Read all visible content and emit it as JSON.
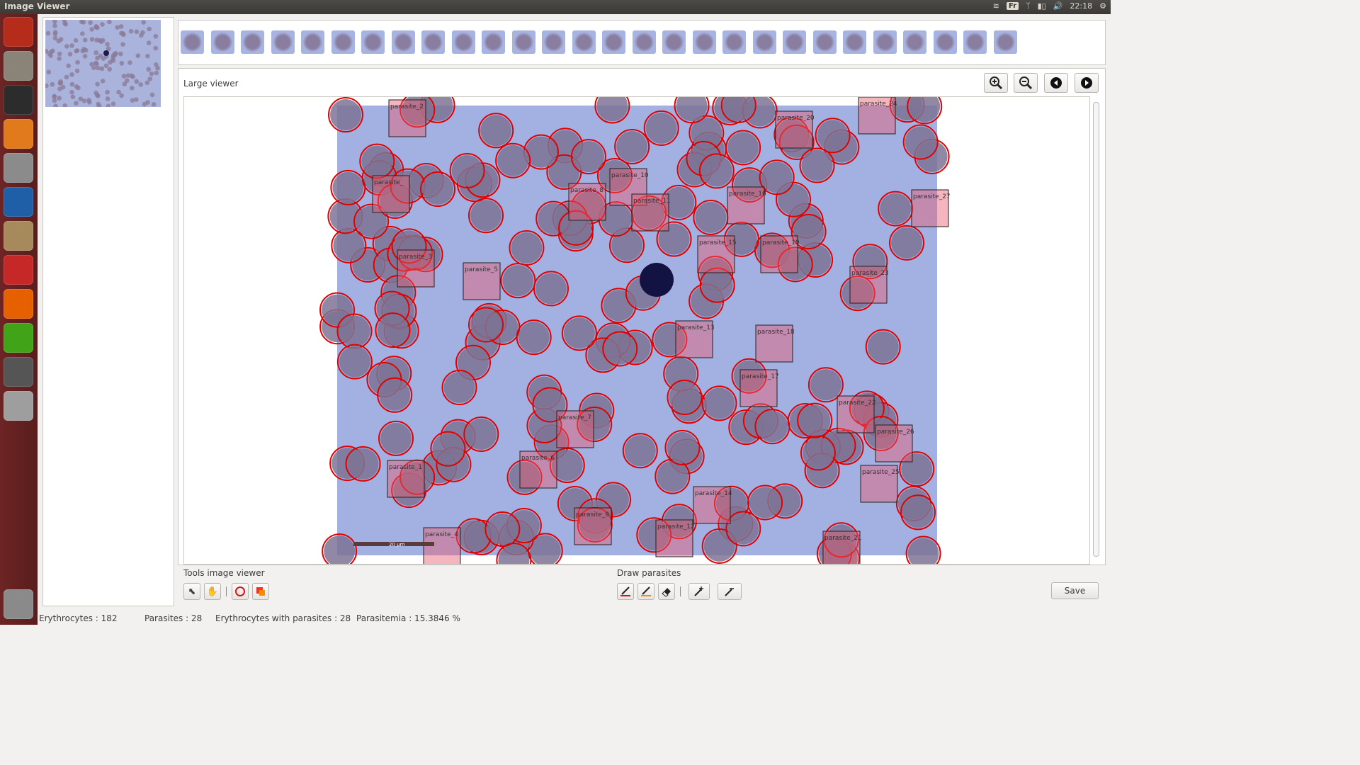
{
  "window": {
    "title": "Image Viewer"
  },
  "tray": {
    "keyboard": "Fr",
    "time": "22:18"
  },
  "launcher": {
    "items": [
      {
        "name": "ubuntu-icon",
        "color": "#b52c1a"
      },
      {
        "name": "files-icon",
        "color": "#8a8478"
      },
      {
        "name": "terminal-icon",
        "color": "#2c2c2c"
      },
      {
        "name": "software-center-icon",
        "color": "#e07a1b"
      },
      {
        "name": "system-settings-icon",
        "color": "#8b8b8b"
      },
      {
        "name": "system-monitor-icon",
        "color": "#1f5fa8"
      },
      {
        "name": "archive-icon",
        "color": "#a68a5b"
      },
      {
        "name": "document-viewer-icon",
        "color": "#c62828"
      },
      {
        "name": "firefox-icon",
        "color": "#e66000"
      },
      {
        "name": "qt-creator-icon",
        "color": "#41a317"
      },
      {
        "name": "software-updater-icon",
        "color": "#555555"
      },
      {
        "name": "help-icon",
        "color": "#9e9e9e"
      }
    ],
    "trash": {
      "name": "trash-icon",
      "color": "#8a8a8a"
    }
  },
  "viewer": {
    "label": "Large viewer",
    "zoom_in": "zoom-in-icon",
    "zoom_out": "zoom-out-icon",
    "prev": "previous-icon",
    "next": "next-icon",
    "scale_bar": "20 µm"
  },
  "parasites": [
    {
      "label": "parasite_1"
    },
    {
      "label": "parasite_2"
    },
    {
      "label": "parasite_3"
    },
    {
      "label": "parasite_4"
    },
    {
      "label": "parasite_5"
    },
    {
      "label": "parasite_6"
    },
    {
      "label": "parasite_7"
    },
    {
      "label": "parasite_8"
    },
    {
      "label": "parasite_9"
    },
    {
      "label": "parasite_10"
    },
    {
      "label": "parasite_11"
    },
    {
      "label": "parasite_12"
    },
    {
      "label": "parasite_13"
    },
    {
      "label": "parasite_14"
    },
    {
      "label": "parasite_15"
    },
    {
      "label": "parasite_16"
    },
    {
      "label": "parasite_17"
    },
    {
      "label": "parasite_18"
    },
    {
      "label": "parasite_19"
    },
    {
      "label": "parasite_20"
    },
    {
      "label": "parasite_21"
    },
    {
      "label": "parasite_22"
    },
    {
      "label": "parasite_23"
    },
    {
      "label": "parasite_24"
    },
    {
      "label": "parasite_25"
    },
    {
      "label": "parasite_26"
    },
    {
      "label": "parasite_27"
    },
    {
      "label": "parasite_"
    }
  ],
  "tools": {
    "label": "Tools image viewer",
    "buttons": [
      "pointer-icon",
      "hand-icon",
      "draw-circle-icon",
      "draw-rect-icon"
    ]
  },
  "draw": {
    "label": "Draw parasites",
    "buttons": [
      "pen-red-icon",
      "pen-orange-icon",
      "eraser-icon",
      "add-point-icon",
      "remove-point-icon"
    ]
  },
  "save_label": "Save",
  "status": {
    "erythrocytes": "Erythrocytes : 182",
    "parasites": "Parasites : 28",
    "infected": "Erythrocytes with parasites : 28",
    "parasitemia": "Parasitemia : 15.3846 %"
  }
}
